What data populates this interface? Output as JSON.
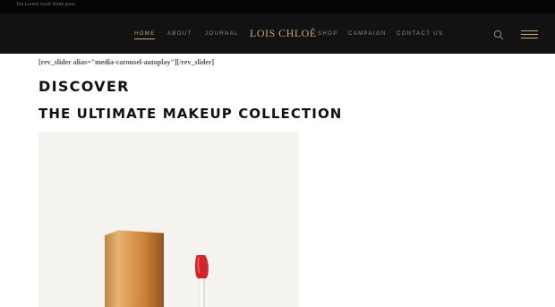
{
  "topbar": {
    "annotation": "The Lorelei Swift Wolfe press"
  },
  "nav": {
    "left": [
      {
        "label": "HOME",
        "active": true
      },
      {
        "label": "ABOUT",
        "active": false
      },
      {
        "label": "JOURNAL",
        "active": false
      }
    ],
    "logo": "LOIS CHLOÉ",
    "right": [
      {
        "label": "SHOP"
      },
      {
        "label": "CAMPAIGN"
      },
      {
        "label": "CONTACT US"
      }
    ],
    "icons": [
      "search-icon",
      "hamburger-menu-icon"
    ]
  },
  "content": {
    "shortcode": "[rev_slider alias=\"media-carousel-autoplay\"][/rev_slider]",
    "heading_1": "DISCOVER",
    "heading_2": "THE ULTIMATE MAKEUP COLLECTION"
  },
  "colors": {
    "accent_gold": "#c9a77a",
    "header_bg": "#121212",
    "topbar_bg": "#050505",
    "lip_red": "#d4242a"
  }
}
